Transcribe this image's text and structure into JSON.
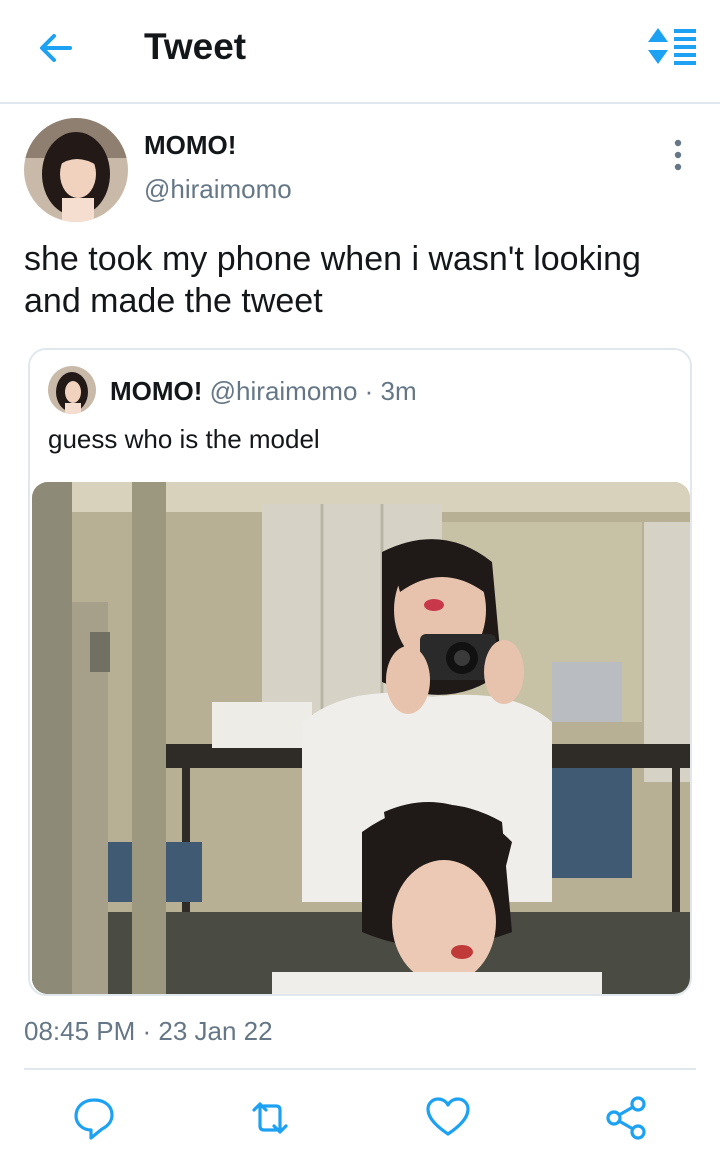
{
  "header": {
    "title": "Tweet",
    "back_icon": "arrow-left-icon",
    "sort_icon": "sort-list-icon",
    "accent_color": "#1da1f2"
  },
  "tweet": {
    "display_name": "MOMO!",
    "handle": "@hiraimomo",
    "text": "she took my phone when i wasn't looking and made the tweet",
    "timestamp": "08:45 PM · 23 Jan 22"
  },
  "quoted_tweet": {
    "display_name": "MOMO!",
    "handle": "@hiraimomo",
    "time": "· 3m",
    "text": "guess who is the model"
  },
  "actions": [
    {
      "icon": "reply-icon"
    },
    {
      "icon": "retweet-icon"
    },
    {
      "icon": "like-icon"
    },
    {
      "icon": "share-icon"
    }
  ]
}
